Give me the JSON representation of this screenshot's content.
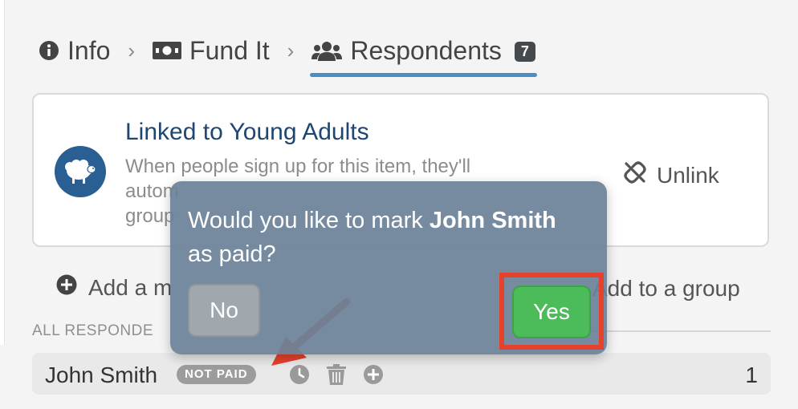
{
  "breadcrumb": {
    "items": [
      {
        "label": "Info",
        "icon": "info-circle-icon"
      },
      {
        "label": "Fund It",
        "icon": "money-bill-icon"
      },
      {
        "label": "Respondents",
        "icon": "users-icon",
        "count": "7",
        "active": true
      }
    ],
    "separator": "›"
  },
  "linked_card": {
    "title": "Linked to Young Adults",
    "description_line1": "When people sign up for this item, they'll",
    "description_line2": "autom",
    "description_line3": "group",
    "unlink_label": "Unlink",
    "group_icon": "sheep-icon",
    "unlink_icon": "unlink-icon"
  },
  "actions": {
    "add_left_label": "Add a m",
    "add_right_label": "Add to a group"
  },
  "section_label": "ALL RESPONDE",
  "respondent": {
    "name": "John Smith",
    "status": "NOT PAID",
    "quantity": "1"
  },
  "popover": {
    "text_before": "Would you like to mark ",
    "name": "John Smith",
    "text_after": " as paid?",
    "no_label": "No",
    "yes_label": "Yes"
  },
  "colors": {
    "accent": "#4a8ec2",
    "highlight": "#e6412d",
    "yes_green": "#4cbb5a"
  }
}
